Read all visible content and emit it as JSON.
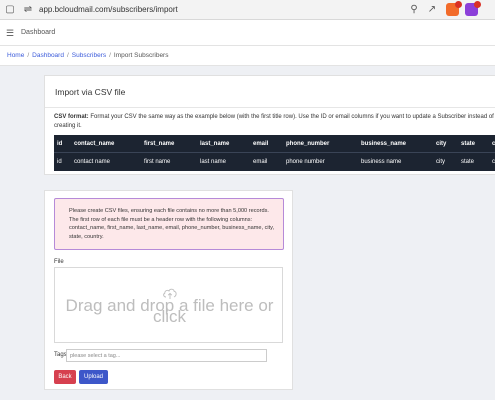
{
  "browser": {
    "url": "app.bcloudmail.com/subscribers/import"
  },
  "header": {
    "title": "Dashboard"
  },
  "breadcrumb": {
    "items": [
      "Home",
      "Dashboard",
      "Subscribers"
    ],
    "separator": "/",
    "current": "Import Subscribers"
  },
  "csv_card": {
    "title": "Import via CSV file",
    "format_label": "CSV format:",
    "format_text": " Format your CSV the same way as the example below (with the first title row). Use the ID or email columns if you want to update a Subscriber instead of creating it.",
    "columns": [
      "id",
      "contact_name",
      "first_name",
      "last_name",
      "email",
      "phone_number",
      "business_name",
      "city",
      "state",
      "c"
    ],
    "row": [
      "id",
      "contact name",
      "first name",
      "last name",
      "email",
      "phone number",
      "business name",
      "city",
      "state",
      "c"
    ]
  },
  "upload": {
    "notice": "Please create CSV files, ensuring each file contains no more than 5,000 records. The first row of each file must be a header row with the following columns: contact_name, first_name, last_name, email, phone_number, business_name, city, state, country.",
    "file_label": "File",
    "dropzone_text": "Drag and drop a file here or click",
    "tags_label": "Tags",
    "tags_placeholder": "please select a tag...",
    "back_label": "Back",
    "upload_label": "Upload"
  },
  "colors": {
    "accent": "#3d57c9",
    "danger": "#d6404f",
    "table_bg": "#1c2431",
    "alert_bg": "#fde8ea",
    "alert_border": "#b68ad8"
  },
  "icons": {
    "browser": [
      "page-icon",
      "site-settings-icon",
      "zoom-icon",
      "share-icon",
      "brave-shield-icon",
      "brave-rewards-icon"
    ],
    "dropzone": "cloud-upload-icon"
  }
}
